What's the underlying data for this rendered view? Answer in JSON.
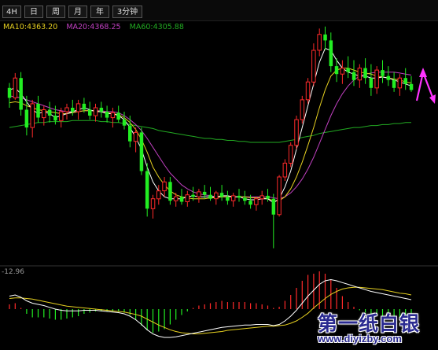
{
  "toolbar": {
    "buttons": [
      "4H",
      "日",
      "周",
      "月",
      "年",
      "3分钟"
    ]
  },
  "legend": {
    "ma10": "MA10:4363.20",
    "ma20": "MA20:4368.25",
    "ma60": "MA60:4305.88"
  },
  "macd_label": "-12.96",
  "watermark": {
    "title": "第一纸白银",
    "url": "www.diyizby.com"
  },
  "colors": {
    "up": "#ff2a2a",
    "down": "#22ee22",
    "ma10": "#e6d020",
    "ma20": "#c040c0",
    "ma60": "#22aa22",
    "ma5": "#ffffff",
    "arrow": "#ff33ff",
    "diff": "#ffffff",
    "dea": "#e6d020"
  },
  "chart_data": {
    "type": "candlestick",
    "y_range": [
      4205,
      4445
    ],
    "candles": [
      [
        4380,
        4385,
        4360,
        4370
      ],
      [
        4370,
        4395,
        4368,
        4390
      ],
      [
        4390,
        4396,
        4352,
        4358
      ],
      [
        4358,
        4372,
        4332,
        4340
      ],
      [
        4340,
        4368,
        4330,
        4364
      ],
      [
        4364,
        4372,
        4345,
        4350
      ],
      [
        4350,
        4362,
        4342,
        4358
      ],
      [
        4358,
        4366,
        4345,
        4352
      ],
      [
        4352,
        4362,
        4343,
        4347
      ],
      [
        4347,
        4360,
        4340,
        4356
      ],
      [
        4356,
        4364,
        4348,
        4360
      ],
      [
        4360,
        4368,
        4352,
        4356
      ],
      [
        4356,
        4368,
        4348,
        4364
      ],
      [
        4364,
        4370,
        4355,
        4358
      ],
      [
        4358,
        4366,
        4348,
        4352
      ],
      [
        4352,
        4364,
        4346,
        4360
      ],
      [
        4360,
        4366,
        4350,
        4356
      ],
      [
        4356,
        4362,
        4345,
        4350
      ],
      [
        4350,
        4360,
        4340,
        4355
      ],
      [
        4355,
        4362,
        4345,
        4348
      ],
      [
        4348,
        4356,
        4338,
        4342
      ],
      [
        4342,
        4352,
        4320,
        4326
      ],
      [
        4326,
        4340,
        4315,
        4335
      ],
      [
        4335,
        4340,
        4292,
        4296
      ],
      [
        4296,
        4304,
        4250,
        4258
      ],
      [
        4258,
        4272,
        4248,
        4268
      ],
      [
        4268,
        4282,
        4262,
        4276
      ],
      [
        4276,
        4290,
        4270,
        4285
      ],
      [
        4285,
        4290,
        4262,
        4266
      ],
      [
        4266,
        4274,
        4260,
        4270
      ],
      [
        4270,
        4278,
        4262,
        4265
      ],
      [
        4265,
        4276,
        4260,
        4272
      ],
      [
        4272,
        4280,
        4266,
        4270
      ],
      [
        4270,
        4278,
        4264,
        4275
      ],
      [
        4275,
        4282,
        4268,
        4272
      ],
      [
        4272,
        4280,
        4266,
        4268
      ],
      [
        4268,
        4276,
        4262,
        4274
      ],
      [
        4274,
        4282,
        4266,
        4270
      ],
      [
        4270,
        4276,
        4262,
        4266
      ],
      [
        4266,
        4274,
        4260,
        4271
      ],
      [
        4271,
        4278,
        4265,
        4269
      ],
      [
        4269,
        4276,
        4262,
        4266
      ],
      [
        4266,
        4272,
        4258,
        4262
      ],
      [
        4262,
        4270,
        4256,
        4268
      ],
      [
        4268,
        4276,
        4262,
        4271
      ],
      [
        4271,
        4278,
        4265,
        4268
      ],
      [
        4268,
        4273,
        4218,
        4252
      ],
      [
        4252,
        4292,
        4250,
        4290
      ],
      [
        4290,
        4308,
        4286,
        4304
      ],
      [
        4304,
        4325,
        4300,
        4322
      ],
      [
        4322,
        4352,
        4318,
        4348
      ],
      [
        4348,
        4372,
        4344,
        4368
      ],
      [
        4368,
        4390,
        4364,
        4386
      ],
      [
        4386,
        4425,
        4382,
        4418
      ],
      [
        4418,
        4440,
        4412,
        4434
      ],
      [
        4434,
        4442,
        4418,
        4428
      ],
      [
        4428,
        4436,
        4396,
        4402
      ],
      [
        4402,
        4410,
        4386,
        4394
      ],
      [
        4394,
        4408,
        4384,
        4400
      ],
      [
        4400,
        4412,
        4390,
        4396
      ],
      [
        4396,
        4408,
        4382,
        4388
      ],
      [
        4388,
        4404,
        4380,
        4400
      ],
      [
        4400,
        4410,
        4384,
        4390
      ],
      [
        4390,
        4404,
        4372,
        4380
      ],
      [
        4380,
        4402,
        4374,
        4398
      ],
      [
        4398,
        4408,
        4385,
        4392
      ],
      [
        4392,
        4402,
        4382,
        4388
      ],
      [
        4388,
        4396,
        4376,
        4380
      ],
      [
        4380,
        4394,
        4372,
        4390
      ],
      [
        4390,
        4400,
        4378,
        4384
      ],
      [
        4384,
        4392,
        4376,
        4378
      ]
    ],
    "ma5": [
      4378,
      4380,
      4374,
      4366,
      4358,
      4354,
      4356,
      4354,
      4350,
      4352,
      4354,
      4356,
      4358,
      4360,
      4358,
      4356,
      4356,
      4354,
      4354,
      4352,
      4348,
      4340,
      4330,
      4318,
      4300,
      4285,
      4276,
      4270,
      4268,
      4268,
      4268,
      4270,
      4271,
      4270,
      4270,
      4270,
      4270,
      4271,
      4271,
      4270,
      4270,
      4268,
      4267,
      4267,
      4268,
      4268,
      4264,
      4268,
      4280,
      4296,
      4318,
      4340,
      4362,
      4384,
      4406,
      4420,
      4418,
      4408,
      4400,
      4396,
      4394,
      4392,
      4392,
      4390,
      4390,
      4391,
      4390,
      4388,
      4386,
      4384,
      4382
    ],
    "ma10": [
      4365,
      4366,
      4365,
      4362,
      4360,
      4358,
      4357,
      4356,
      4355,
      4354,
      4354,
      4355,
      4356,
      4357,
      4357,
      4357,
      4356,
      4355,
      4354,
      4353,
      4350,
      4345,
      4338,
      4328,
      4315,
      4300,
      4290,
      4282,
      4276,
      4272,
      4270,
      4269,
      4268,
      4268,
      4268,
      4269,
      4269,
      4270,
      4270,
      4270,
      4270,
      4270,
      4269,
      4269,
      4269,
      4268,
      4266,
      4266,
      4270,
      4278,
      4290,
      4305,
      4322,
      4340,
      4360,
      4378,
      4392,
      4398,
      4400,
      4400,
      4398,
      4396,
      4395,
      4394,
      4392,
      4391,
      4390,
      4389,
      4388,
      4386,
      4385
    ],
    "ma20": [
      4372,
      4371,
      4370,
      4368,
      4366,
      4364,
      4362,
      4360,
      4358,
      4357,
      4356,
      4356,
      4356,
      4357,
      4357,
      4357,
      4357,
      4356,
      4356,
      4355,
      4352,
      4348,
      4343,
      4337,
      4329,
      4320,
      4311,
      4302,
      4294,
      4288,
      4282,
      4278,
      4275,
      4273,
      4272,
      4271,
      4270,
      4270,
      4270,
      4270,
      4270,
      4270,
      4270,
      4270,
      4270,
      4270,
      4269,
      4268,
      4270,
      4274,
      4280,
      4288,
      4298,
      4310,
      4324,
      4338,
      4352,
      4364,
      4374,
      4382,
      4388,
      4392,
      4394,
      4395,
      4396,
      4396,
      4396,
      4396,
      4395,
      4394,
      4393
    ],
    "ma60": [
      4340,
      4341,
      4342,
      4343,
      4344,
      4345,
      4345,
      4346,
      4346,
      4346,
      4346,
      4347,
      4347,
      4347,
      4347,
      4347,
      4346,
      4346,
      4345,
      4345,
      4344,
      4343,
      4342,
      4341,
      4340,
      4339,
      4337,
      4336,
      4335,
      4334,
      4333,
      4332,
      4331,
      4330,
      4329,
      4329,
      4328,
      4328,
      4327,
      4327,
      4326,
      4326,
      4325,
      4325,
      4325,
      4325,
      4325,
      4325,
      4326,
      4327,
      4328,
      4330,
      4331,
      4332,
      4334,
      4335,
      4336,
      4337,
      4338,
      4339,
      4340,
      4340,
      4341,
      4342,
      4342,
      4343,
      4343,
      4344,
      4344,
      4345,
      4345
    ],
    "macd_range": [
      -60,
      60
    ],
    "diff": [
      22,
      24,
      20,
      14,
      10,
      8,
      6,
      3,
      0,
      -2,
      -3,
      -3,
      -3,
      -2,
      -2,
      -2,
      -3,
      -4,
      -5,
      -6,
      -8,
      -12,
      -18,
      -26,
      -35,
      -42,
      -46,
      -48,
      -48,
      -47,
      -45,
      -43,
      -41,
      -39,
      -37,
      -35,
      -33,
      -31,
      -30,
      -29,
      -28,
      -27,
      -27,
      -26,
      -26,
      -26,
      -28,
      -26,
      -20,
      -12,
      -2,
      10,
      22,
      32,
      42,
      48,
      50,
      48,
      45,
      42,
      39,
      36,
      33,
      30,
      28,
      26,
      24,
      22,
      20,
      18,
      16
    ],
    "dea": [
      18,
      19,
      19,
      18,
      17,
      15,
      13,
      11,
      9,
      7,
      5,
      4,
      3,
      2,
      1,
      0,
      -1,
      -2,
      -3,
      -4,
      -5,
      -7,
      -9,
      -12,
      -17,
      -22,
      -27,
      -31,
      -35,
      -38,
      -40,
      -41,
      -42,
      -42,
      -41,
      -40,
      -39,
      -38,
      -36,
      -35,
      -34,
      -33,
      -32,
      -31,
      -30,
      -29,
      -29,
      -28,
      -27,
      -24,
      -20,
      -14,
      -7,
      2,
      10,
      18,
      25,
      30,
      34,
      36,
      37,
      37,
      36,
      35,
      34,
      33,
      31,
      29,
      27,
      26,
      24
    ]
  }
}
